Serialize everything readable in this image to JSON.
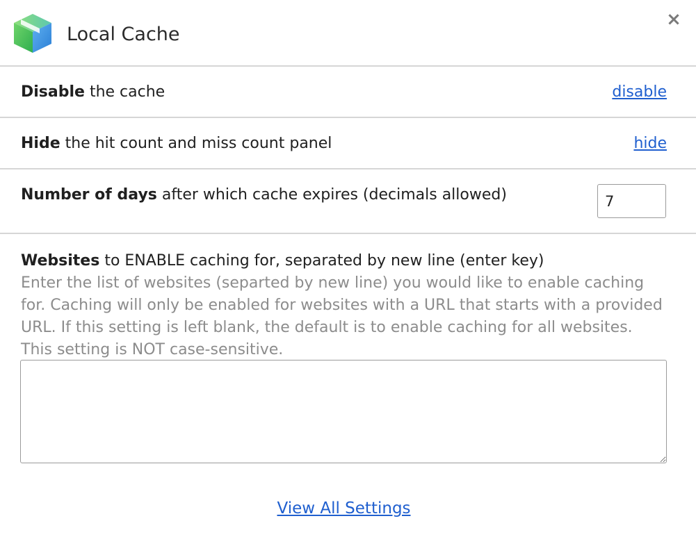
{
  "header": {
    "title": "Local Cache",
    "logo_icon": "cube-icon",
    "close_label": "×"
  },
  "rows": {
    "disable": {
      "bold": "Disable",
      "text": " the cache",
      "link": "disable"
    },
    "hide": {
      "bold": "Hide",
      "text": " the hit count and miss count panel",
      "link": "hide"
    },
    "days": {
      "bold": "Number of days",
      "text": " after which cache expires (decimals allowed)",
      "value": "7"
    }
  },
  "websites": {
    "bold": "Websites",
    "text": " to ENABLE caching for, separated by new line (enter key)",
    "description": "Enter the list of websites (separted by new line) you would like to enable caching for. Caching will only be enabled for websites with a URL that starts with a provided URL. If this setting is left blank, the default is to enable caching for all websites. This setting is NOT case-sensitive.",
    "value": ""
  },
  "footer": {
    "link": "View All Settings"
  },
  "colors": {
    "link": "#1f5fcf",
    "divider": "#d6d6d6",
    "muted_text": "#8c8c8c",
    "logo_green": "#3fbf5a",
    "logo_blue": "#3b8fe0"
  }
}
